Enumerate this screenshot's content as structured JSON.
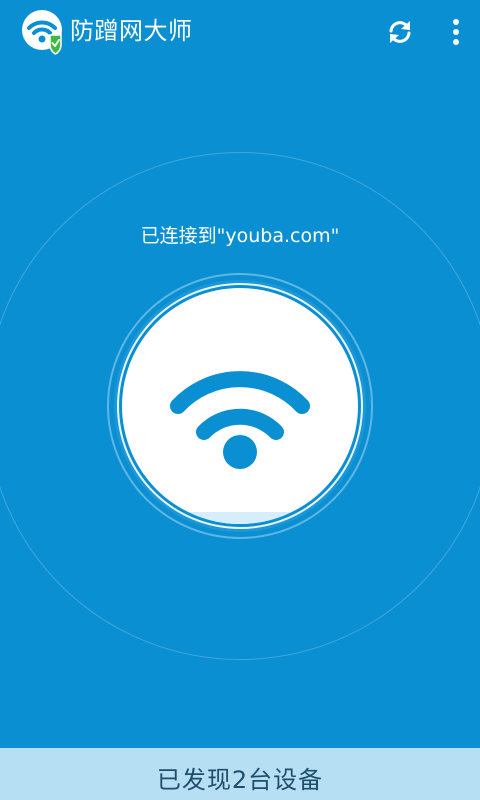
{
  "header": {
    "title": "防蹭网大师",
    "logo_icon": "wifi-shield-icon",
    "refresh_icon": "refresh-icon",
    "more_icon": "more-vertical-icon"
  },
  "main": {
    "status_text": "已连接到\"youba.com\"",
    "center_icon": "wifi-icon"
  },
  "footer": {
    "devices_label": "已发现2台设备"
  },
  "colors": {
    "background": "#0a8fd3",
    "footer_bg": "#b7dff4",
    "icon_blue": "#0a8fd3",
    "shield_green": "#3dbb3a"
  }
}
